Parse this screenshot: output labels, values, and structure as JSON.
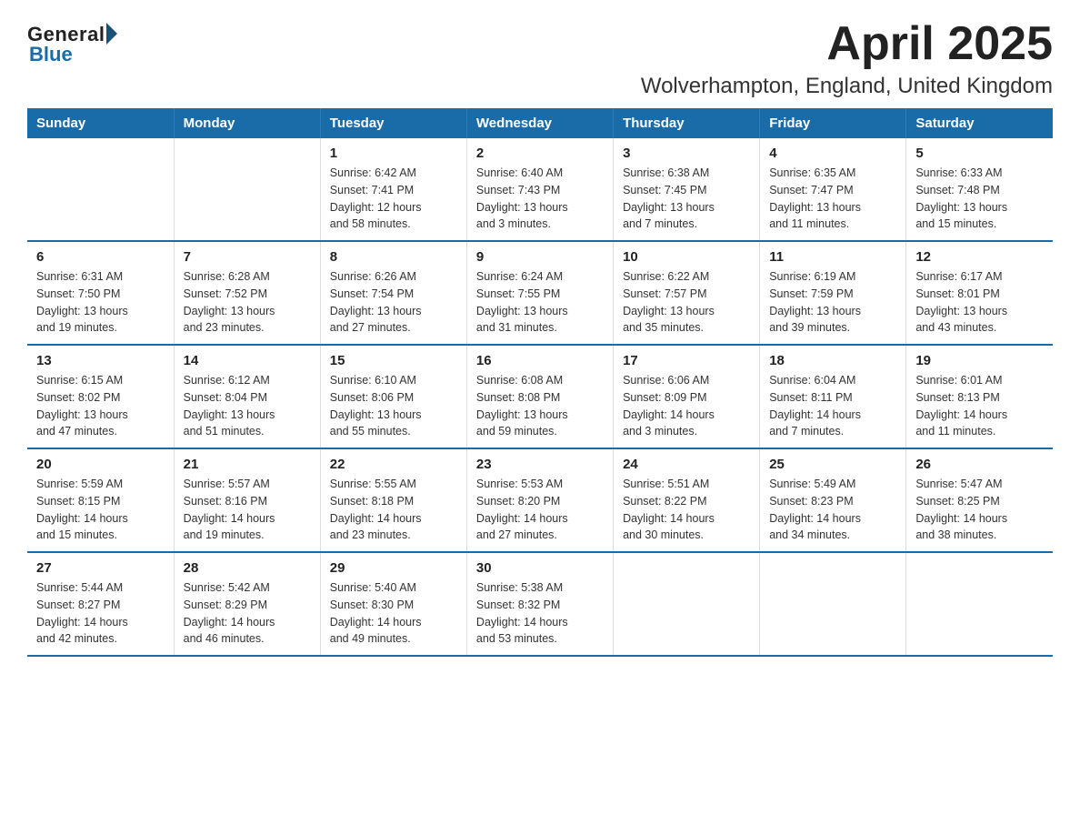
{
  "logo": {
    "general": "General",
    "blue": "Blue"
  },
  "title": "April 2025",
  "subtitle": "Wolverhampton, England, United Kingdom",
  "header": {
    "days": [
      "Sunday",
      "Monday",
      "Tuesday",
      "Wednesday",
      "Thursday",
      "Friday",
      "Saturday"
    ]
  },
  "weeks": [
    {
      "days": [
        {
          "number": "",
          "info": ""
        },
        {
          "number": "",
          "info": ""
        },
        {
          "number": "1",
          "info": "Sunrise: 6:42 AM\nSunset: 7:41 PM\nDaylight: 12 hours\nand 58 minutes."
        },
        {
          "number": "2",
          "info": "Sunrise: 6:40 AM\nSunset: 7:43 PM\nDaylight: 13 hours\nand 3 minutes."
        },
        {
          "number": "3",
          "info": "Sunrise: 6:38 AM\nSunset: 7:45 PM\nDaylight: 13 hours\nand 7 minutes."
        },
        {
          "number": "4",
          "info": "Sunrise: 6:35 AM\nSunset: 7:47 PM\nDaylight: 13 hours\nand 11 minutes."
        },
        {
          "number": "5",
          "info": "Sunrise: 6:33 AM\nSunset: 7:48 PM\nDaylight: 13 hours\nand 15 minutes."
        }
      ]
    },
    {
      "days": [
        {
          "number": "6",
          "info": "Sunrise: 6:31 AM\nSunset: 7:50 PM\nDaylight: 13 hours\nand 19 minutes."
        },
        {
          "number": "7",
          "info": "Sunrise: 6:28 AM\nSunset: 7:52 PM\nDaylight: 13 hours\nand 23 minutes."
        },
        {
          "number": "8",
          "info": "Sunrise: 6:26 AM\nSunset: 7:54 PM\nDaylight: 13 hours\nand 27 minutes."
        },
        {
          "number": "9",
          "info": "Sunrise: 6:24 AM\nSunset: 7:55 PM\nDaylight: 13 hours\nand 31 minutes."
        },
        {
          "number": "10",
          "info": "Sunrise: 6:22 AM\nSunset: 7:57 PM\nDaylight: 13 hours\nand 35 minutes."
        },
        {
          "number": "11",
          "info": "Sunrise: 6:19 AM\nSunset: 7:59 PM\nDaylight: 13 hours\nand 39 minutes."
        },
        {
          "number": "12",
          "info": "Sunrise: 6:17 AM\nSunset: 8:01 PM\nDaylight: 13 hours\nand 43 minutes."
        }
      ]
    },
    {
      "days": [
        {
          "number": "13",
          "info": "Sunrise: 6:15 AM\nSunset: 8:02 PM\nDaylight: 13 hours\nand 47 minutes."
        },
        {
          "number": "14",
          "info": "Sunrise: 6:12 AM\nSunset: 8:04 PM\nDaylight: 13 hours\nand 51 minutes."
        },
        {
          "number": "15",
          "info": "Sunrise: 6:10 AM\nSunset: 8:06 PM\nDaylight: 13 hours\nand 55 minutes."
        },
        {
          "number": "16",
          "info": "Sunrise: 6:08 AM\nSunset: 8:08 PM\nDaylight: 13 hours\nand 59 minutes."
        },
        {
          "number": "17",
          "info": "Sunrise: 6:06 AM\nSunset: 8:09 PM\nDaylight: 14 hours\nand 3 minutes."
        },
        {
          "number": "18",
          "info": "Sunrise: 6:04 AM\nSunset: 8:11 PM\nDaylight: 14 hours\nand 7 minutes."
        },
        {
          "number": "19",
          "info": "Sunrise: 6:01 AM\nSunset: 8:13 PM\nDaylight: 14 hours\nand 11 minutes."
        }
      ]
    },
    {
      "days": [
        {
          "number": "20",
          "info": "Sunrise: 5:59 AM\nSunset: 8:15 PM\nDaylight: 14 hours\nand 15 minutes."
        },
        {
          "number": "21",
          "info": "Sunrise: 5:57 AM\nSunset: 8:16 PM\nDaylight: 14 hours\nand 19 minutes."
        },
        {
          "number": "22",
          "info": "Sunrise: 5:55 AM\nSunset: 8:18 PM\nDaylight: 14 hours\nand 23 minutes."
        },
        {
          "number": "23",
          "info": "Sunrise: 5:53 AM\nSunset: 8:20 PM\nDaylight: 14 hours\nand 27 minutes."
        },
        {
          "number": "24",
          "info": "Sunrise: 5:51 AM\nSunset: 8:22 PM\nDaylight: 14 hours\nand 30 minutes."
        },
        {
          "number": "25",
          "info": "Sunrise: 5:49 AM\nSunset: 8:23 PM\nDaylight: 14 hours\nand 34 minutes."
        },
        {
          "number": "26",
          "info": "Sunrise: 5:47 AM\nSunset: 8:25 PM\nDaylight: 14 hours\nand 38 minutes."
        }
      ]
    },
    {
      "days": [
        {
          "number": "27",
          "info": "Sunrise: 5:44 AM\nSunset: 8:27 PM\nDaylight: 14 hours\nand 42 minutes."
        },
        {
          "number": "28",
          "info": "Sunrise: 5:42 AM\nSunset: 8:29 PM\nDaylight: 14 hours\nand 46 minutes."
        },
        {
          "number": "29",
          "info": "Sunrise: 5:40 AM\nSunset: 8:30 PM\nDaylight: 14 hours\nand 49 minutes."
        },
        {
          "number": "30",
          "info": "Sunrise: 5:38 AM\nSunset: 8:32 PM\nDaylight: 14 hours\nand 53 minutes."
        },
        {
          "number": "",
          "info": ""
        },
        {
          "number": "",
          "info": ""
        },
        {
          "number": "",
          "info": ""
        }
      ]
    }
  ]
}
